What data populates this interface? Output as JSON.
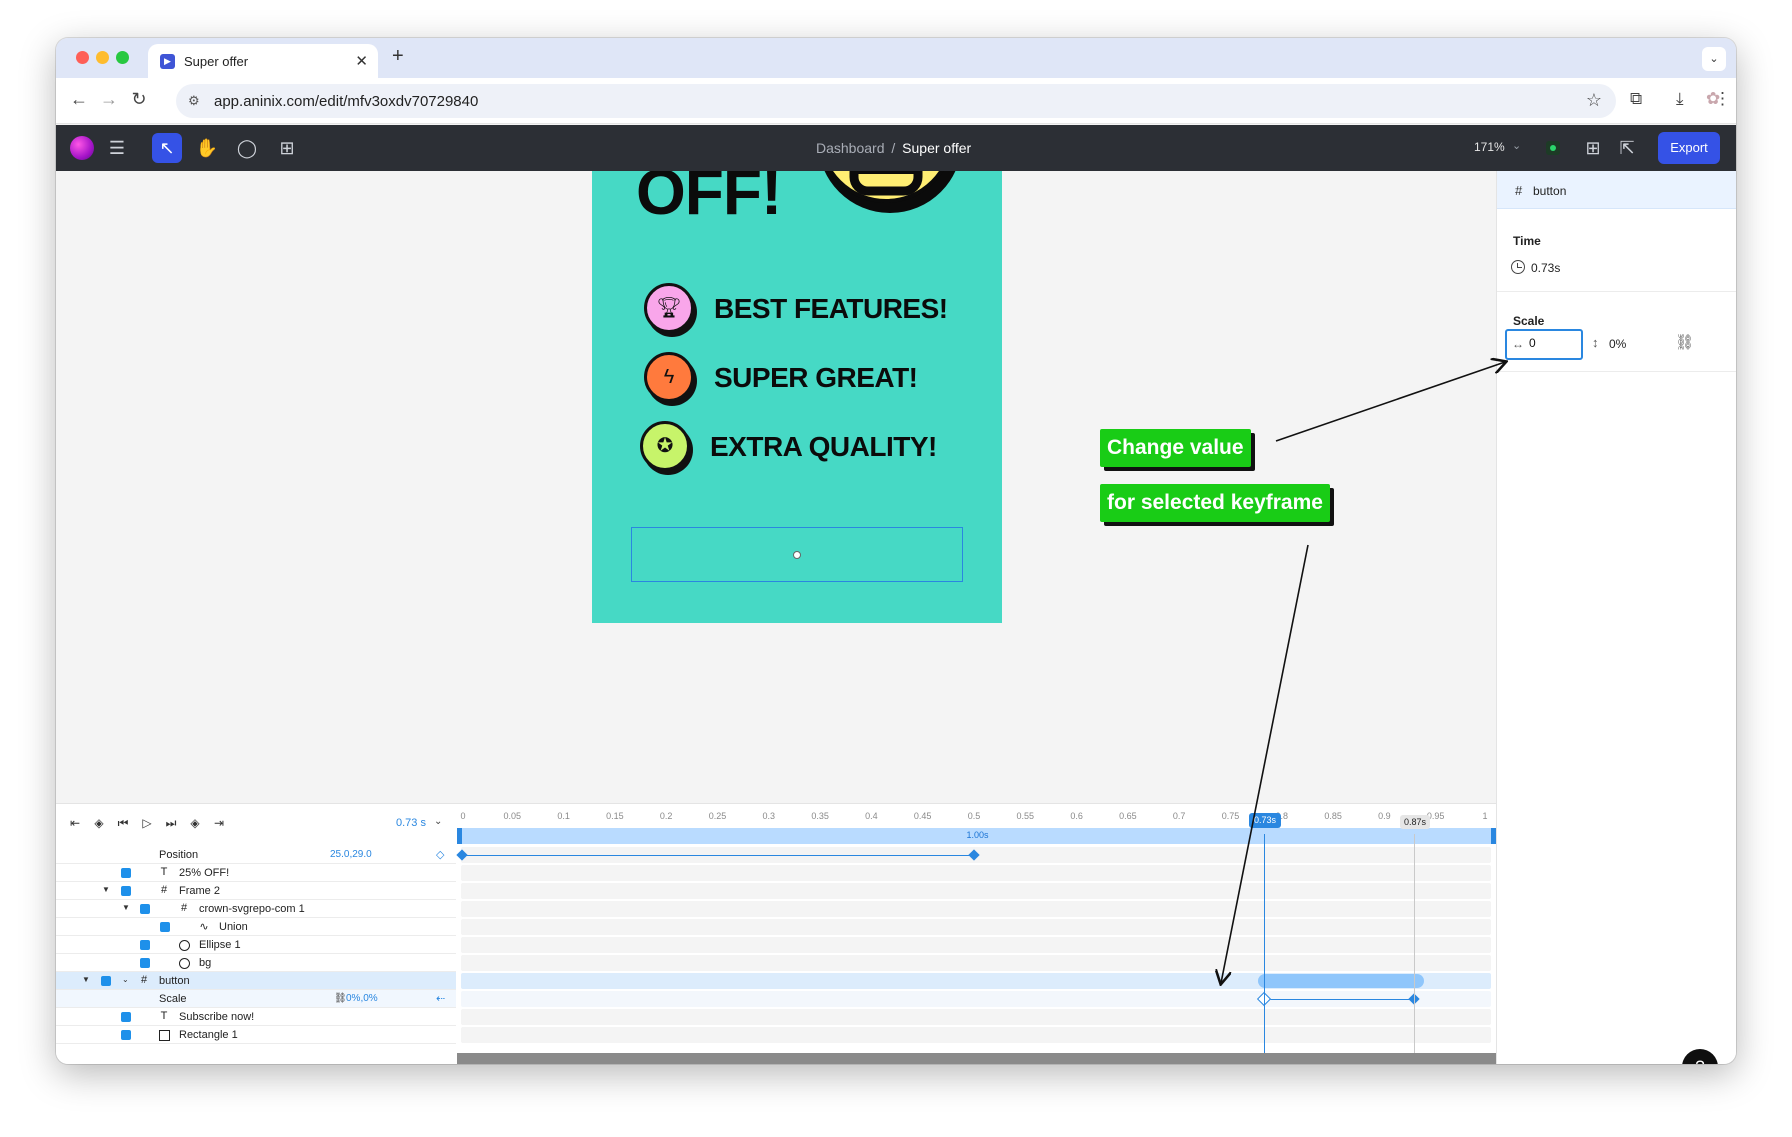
{
  "browser": {
    "tab_title": "Super offer",
    "url": "app.aninix.com/edit/mfv3oxdv70729840"
  },
  "toolbar": {
    "breadcrumb_root": "Dashboard",
    "breadcrumb_sep": "/",
    "breadcrumb_current": "Super offer",
    "zoom": "171%",
    "export_label": "Export",
    "accent_color": "#3552e6"
  },
  "artboard": {
    "off_text": "OFF!",
    "features": [
      {
        "label": "BEST FEATURES!",
        "icon": "trophy-icon",
        "color": "#f9a6ea"
      },
      {
        "label": "SUPER GREAT!",
        "icon": "lightning-icon",
        "color": "#ff7a3d"
      },
      {
        "label": "EXTRA QUALITY!",
        "icon": "medal-icon",
        "color": "#c7f46a"
      }
    ],
    "background_color": "#46d9c5"
  },
  "annotations": {
    "note_1": "Change value",
    "note_2": "for selected keyframe",
    "note_color": "#19cc16"
  },
  "panel": {
    "selected_name": "button",
    "time_title": "Time",
    "time_value": "0.73s",
    "scale_title": "Scale",
    "scale_x_value": "0",
    "scale_y_value": "0%"
  },
  "timeline": {
    "current_time": "0.73",
    "current_time_unit": "s",
    "ticks": [
      "0",
      "0.05",
      "0.1",
      "0.15",
      "0.2",
      "0.25",
      "0.3",
      "0.35",
      "0.4",
      "0.45",
      "0.5",
      "0.55",
      "0.6",
      "0.65",
      "0.7",
      "0.75",
      "0.8",
      "0.85",
      "0.9",
      "0.95",
      "1"
    ],
    "duration_label": "1.00s",
    "playhead_label": "0.73s",
    "marker_label": "0.87s",
    "rows": [
      {
        "name": "Position",
        "value": "25.0,29.0"
      },
      {
        "name": "25% OFF!"
      },
      {
        "name": "Frame 2"
      },
      {
        "name": "crown-svgrepo-com 1"
      },
      {
        "name": "Union"
      },
      {
        "name": "Ellipse 1"
      },
      {
        "name": "bg"
      },
      {
        "name": "button"
      },
      {
        "name": "Scale",
        "value": "0%,0%"
      },
      {
        "name": "Subscribe now!"
      },
      {
        "name": "Rectangle 1"
      }
    ]
  }
}
